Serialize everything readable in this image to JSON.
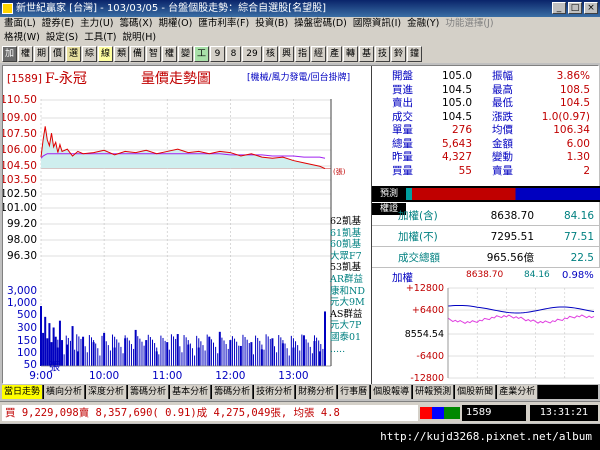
{
  "window": {
    "title": "新世紀贏家 [台灣] - 103/03/05 - 台盤個股走勢：綜合自選股[名望股]",
    "buttons": [
      "_",
      "□",
      "×"
    ]
  },
  "menu1": [
    "畫面(L)",
    "證券(E)",
    "主力(U)",
    "籌碼(X)",
    "期權(O)",
    "匯市利率(F)",
    "投資(B)",
    "操盤密碼(D)",
    "國際資訊(I)",
    "金融(Y)",
    "功能選擇(J)"
  ],
  "menu1_disabled": "功能選擇(J)",
  "menu2": [
    "格視(W)",
    "設定(S)",
    "工具(T)",
    "說明(H)"
  ],
  "toolbar": [
    "加",
    "權",
    "期",
    "價",
    "選",
    "綜",
    "線",
    "類",
    "備",
    "智",
    "權",
    "變",
    "工",
    "9",
    "8",
    "29",
    "核",
    "興",
    "指",
    "經",
    "產",
    "轉",
    "基",
    "技",
    "鈴",
    "鐘"
  ],
  "chart": {
    "code": "[1589]",
    "name": "F-永冠",
    "view": "量價走勢圖",
    "tabs": "[機械/風力發電/回台掛牌]",
    "volume_label": "張",
    "volume_prefix": "(張)",
    "x_labels": [
      "9:00",
      "10:00",
      "11:00",
      "12:00",
      "13:00"
    ]
  },
  "chart_data": {
    "type": "line",
    "price_ticks": [
      110.5,
      109.0,
      107.5,
      106.0,
      104.5,
      103.5,
      102.5,
      101.0,
      99.2,
      98.0,
      96.3
    ],
    "price_tick_labels": [
      "110.50",
      "109.00",
      "107.50",
      "106.00",
      "104.50",
      "103.50",
      "102.50",
      "101.00",
      "99.20",
      "98.00",
      "96.30"
    ],
    "reference_price": 104.5,
    "ylim": [
      96.3,
      110.5
    ],
    "volume_ticks_labels": [
      "3,000",
      "1,000",
      "500",
      "300",
      "150",
      "100",
      "50",
      "25"
    ],
    "x": [
      0,
      2,
      4,
      6,
      8,
      10,
      12,
      14,
      16,
      18,
      20,
      25,
      30,
      35,
      40,
      50,
      60,
      70,
      80,
      90,
      100,
      110,
      120,
      130,
      140,
      150,
      160,
      170,
      180,
      190,
      200,
      210,
      220,
      230,
      240,
      250,
      260,
      265,
      270
    ],
    "price": [
      105.5,
      107.0,
      108.2,
      107.0,
      106.5,
      107.6,
      106.4,
      106.8,
      105.9,
      106.6,
      106.0,
      106.2,
      105.6,
      106.0,
      105.8,
      105.9,
      106.1,
      105.7,
      106.0,
      105.9,
      106.1,
      105.8,
      106.0,
      106.2,
      105.9,
      106.0,
      105.8,
      106.0,
      105.9,
      105.6,
      105.8,
      105.5,
      105.4,
      105.5,
      105.2,
      105.0,
      104.8,
      104.7,
      104.5
    ],
    "avg": [
      105.4,
      105.6,
      105.7,
      105.8,
      105.8,
      105.8,
      105.8,
      105.8,
      105.8,
      105.8,
      105.8,
      105.8,
      105.8,
      105.8,
      105.8,
      105.8,
      105.8,
      105.8,
      105.8,
      105.8,
      105.8,
      105.8,
      105.8,
      105.8,
      105.8,
      105.8,
      105.8,
      105.8,
      105.7,
      105.7,
      105.7,
      105.7,
      105.6,
      105.6,
      105.6,
      105.5,
      105.5,
      105.5,
      105.4
    ],
    "volume": [
      900,
      120,
      400,
      80,
      250,
      60,
      180,
      90,
      40,
      300,
      70,
      50,
      200,
      30,
      90,
      60,
      120,
      40,
      80,
      150,
      70,
      30,
      60,
      110,
      50,
      40,
      90,
      130,
      70,
      45,
      60,
      35,
      80,
      55,
      40,
      100,
      65,
      30,
      600
    ]
  },
  "quote": {
    "rows": [
      {
        "l1": "開盤",
        "v1": "105.0",
        "l2": "振幅",
        "v2": "3.86%"
      },
      {
        "l1": "買進",
        "v1": "104.5",
        "l2": "最高",
        "v2": "108.5"
      },
      {
        "l1": "賣出",
        "v1": "105.0",
        "l2": "最低",
        "v2": "104.5"
      },
      {
        "l1": "成交",
        "v1": "104.5",
        "l2": "漲跌",
        "v2": "1.0(0.97)"
      },
      {
        "l1": "單量",
        "v1": "276",
        "l2": "均價",
        "v2": "106.34"
      },
      {
        "l1": "總量",
        "v1": "5,643",
        "l2": "金額",
        "v2": "6.00"
      },
      {
        "l1": "昨量",
        "v1": "4,327",
        "l2": "變動",
        "v2": "1.30"
      },
      {
        "l1": "買量",
        "v1": "55",
        "l2": "賣量",
        "v2": "2"
      }
    ]
  },
  "side_tabs": [
    "預測",
    "權證"
  ],
  "broker_list": [
    "62凱基",
    "61凱基",
    "60凱基",
    "大眾F7",
    "53凱基",
    "AR群益",
    "康和ND",
    "元大9M",
    "AS群益",
    "元大7P",
    "國泰01",
    "....."
  ],
  "index": {
    "rows": [
      {
        "label": "加權(含)",
        "value": "8638.70",
        "change": "84.16"
      },
      {
        "label": "加權(不)",
        "value": "7295.51",
        "change": "77.51"
      },
      {
        "label": "成交總額",
        "value": "965.56億",
        "change": "22.5"
      }
    ],
    "mini_title": "加權",
    "mini_value": "8638.70",
    "mini_change": "84.16",
    "mini_pct": "0.98%",
    "mini_ticks": [
      "+12800",
      "+6400",
      "8554.54",
      "-6400",
      "-12800"
    ]
  },
  "bottom_tabs": [
    "當日走勢",
    "橫向分析",
    "深度分析",
    "籌碼分析",
    "基本分析",
    "籌碼分析",
    "技術分析",
    "財務分析",
    "行事曆",
    "個股報導",
    "研報預測",
    "個股新聞",
    "產業分析"
  ],
  "status": {
    "ticker": "買 9,229,098賣 8,357,690( 0.91)成 4,275,049張, 均張 4.8",
    "code": "1589",
    "time": "13:31:21"
  },
  "footer_url": "http://kujd3268.pixnet.net/album"
}
